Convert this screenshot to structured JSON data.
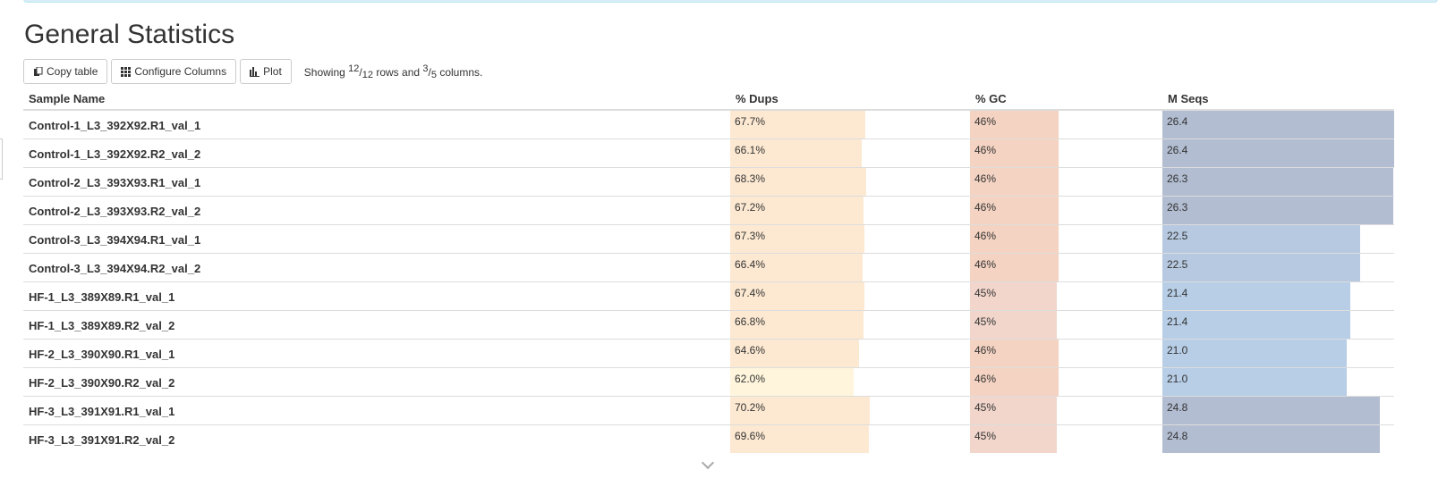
{
  "page": {
    "title": "General Statistics"
  },
  "toolbar": {
    "copy_label": "Copy table",
    "configure_label": "Configure Columns",
    "plot_label": "Plot",
    "showing_prefix": "Showing",
    "rows_shown": "12",
    "rows_total": "12",
    "rows_word": "rows and",
    "cols_shown": "3",
    "cols_total": "5",
    "cols_word": "columns."
  },
  "table": {
    "headers": [
      "Sample Name",
      "% Dups",
      "% GC",
      "M Seqs"
    ],
    "rows": [
      {
        "sample": "Control-1_L3_392X92.R1_val_1",
        "dups": "67.7%",
        "gc": "46%",
        "mseqs": "26.4"
      },
      {
        "sample": "Control-1_L3_392X92.R2_val_2",
        "dups": "66.1%",
        "gc": "46%",
        "mseqs": "26.4"
      },
      {
        "sample": "Control-2_L3_393X93.R1_val_1",
        "dups": "68.3%",
        "gc": "46%",
        "mseqs": "26.3"
      },
      {
        "sample": "Control-2_L3_393X93.R2_val_2",
        "dups": "67.2%",
        "gc": "46%",
        "mseqs": "26.3"
      },
      {
        "sample": "Control-3_L3_394X94.R1_val_1",
        "dups": "67.3%",
        "gc": "46%",
        "mseqs": "22.5"
      },
      {
        "sample": "Control-3_L3_394X94.R2_val_2",
        "dups": "66.4%",
        "gc": "46%",
        "mseqs": "22.5"
      },
      {
        "sample": "HF-1_L3_389X89.R1_val_1",
        "dups": "67.4%",
        "gc": "45%",
        "mseqs": "21.4"
      },
      {
        "sample": "HF-1_L3_389X89.R2_val_2",
        "dups": "66.8%",
        "gc": "45%",
        "mseqs": "21.4"
      },
      {
        "sample": "HF-2_L3_390X90.R1_val_1",
        "dups": "64.6%",
        "gc": "46%",
        "mseqs": "21.0"
      },
      {
        "sample": "HF-2_L3_390X90.R2_val_2",
        "dups": "62.0%",
        "gc": "46%",
        "mseqs": "21.0"
      },
      {
        "sample": "HF-3_L3_391X91.R1_val_1",
        "dups": "70.2%",
        "gc": "45%",
        "mseqs": "24.8"
      },
      {
        "sample": "HF-3_L3_391X91.R2_val_2",
        "dups": "69.6%",
        "gc": "45%",
        "mseqs": "24.8"
      }
    ]
  },
  "colors": {
    "dups_bar": "#fde9d2",
    "dups_bar_light": "#fef5dc",
    "gc_bar": "#f4d3c2",
    "gc_bar_light": "#f2d6cc",
    "mseqs_bar_high": "#b2bdd1",
    "mseqs_bar_mid": "#b6c9e0",
    "mseqs_bar_low": "#b7cee6"
  },
  "icons": {
    "copy": "copy-icon",
    "configure": "grid-icon",
    "plot": "bar-chart-icon",
    "expand": "chevron-down-icon"
  }
}
